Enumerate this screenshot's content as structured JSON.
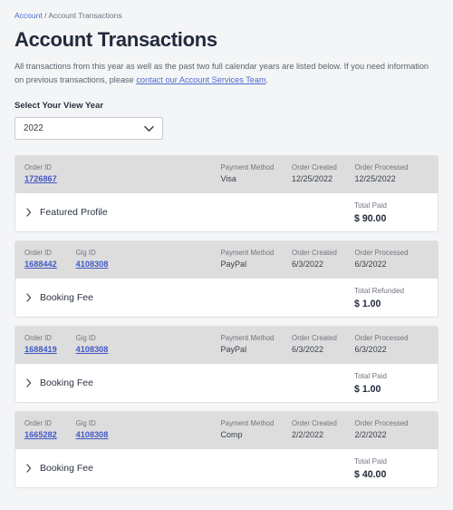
{
  "breadcrumb": {
    "root_label": "Account",
    "separator": "/",
    "current_label": "Account Transactions"
  },
  "header": {
    "title": "Account Transactions",
    "intro_part1": "All transactions from this year as well as the past two full calendar years are listed below. If you need information on previous transactions, please ",
    "intro_link": "contact our Account Services Team",
    "intro_part2": "."
  },
  "view_year": {
    "label": "Select Your View Year",
    "selected": "2022",
    "caret_icon": "chevron-down-icon"
  },
  "columns": {
    "order_id": "Order ID",
    "gig_id": "Gig ID",
    "payment_method": "Payment Method",
    "order_created": "Order Created",
    "order_processed": "Order Processed"
  },
  "colors": {
    "page_background": "#f4f5f6",
    "card_header_background": "#dddddd",
    "card_background": "#ffffff",
    "link": "#4359c4",
    "title": "#222b3c",
    "muted_text": "#6f757f"
  },
  "transactions": [
    {
      "order_id": "1726867",
      "gig_id": "",
      "has_gig": false,
      "payment_method": "Visa",
      "order_created": "12/25/2022",
      "order_processed": "12/25/2022",
      "expand_icon": "chevron-right-icon",
      "item_name": "Featured Profile",
      "total_label": "Total Paid",
      "total_value": "$ 90.00"
    },
    {
      "order_id": "1688442",
      "gig_id": "4108308",
      "has_gig": true,
      "payment_method": "PayPal",
      "order_created": "6/3/2022",
      "order_processed": "6/3/2022",
      "expand_icon": "chevron-right-icon",
      "item_name": "Booking Fee",
      "total_label": "Total Refunded",
      "total_value": "$ 1.00"
    },
    {
      "order_id": "1688419",
      "gig_id": "4108308",
      "has_gig": true,
      "payment_method": "PayPal",
      "order_created": "6/3/2022",
      "order_processed": "6/3/2022",
      "expand_icon": "chevron-right-icon",
      "item_name": "Booking Fee",
      "total_label": "Total Paid",
      "total_value": "$ 1.00"
    },
    {
      "order_id": "1665282",
      "gig_id": "4108308",
      "has_gig": true,
      "payment_method": "Comp",
      "order_created": "2/2/2022",
      "order_processed": "2/2/2022",
      "expand_icon": "chevron-right-icon",
      "item_name": "Booking Fee",
      "total_label": "Total Paid",
      "total_value": "$ 40.00"
    }
  ]
}
